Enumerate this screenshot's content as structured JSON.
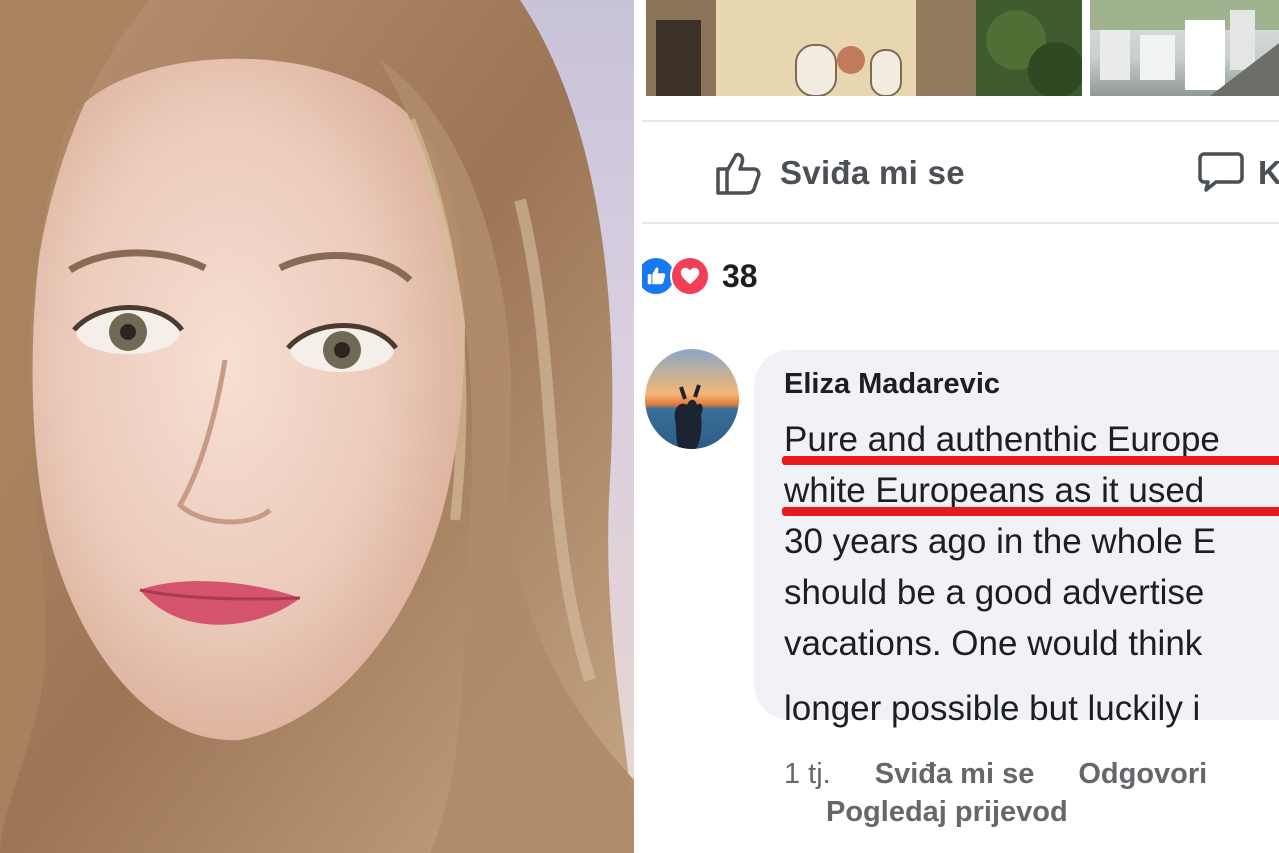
{
  "post": {
    "like_action_label": "Sviđa mi se",
    "comment_action_label": "K",
    "reaction_count": "38"
  },
  "comment": {
    "author": "Eliza Madarevic",
    "lines": [
      "Pure and authenthic Europe",
      "white Europeans as it used",
      "30 years ago in the whole E",
      "should be a good advertise",
      "vacations. One would think",
      "longer possible but luckily i"
    ],
    "time": "1 tj.",
    "like_label": "Sviđa mi se",
    "reply_label": "Odgovori",
    "translate_label": "Pogledaj prijevod"
  },
  "colors": {
    "highlight_underline": "#e8191f",
    "like_blue": "#1877f2",
    "love_red": "#f33e58",
    "bubble_bg": "#f0f2f5"
  },
  "icons": [
    "thumbs-up-icon",
    "comment-icon",
    "like-reaction-icon",
    "love-reaction-icon"
  ]
}
